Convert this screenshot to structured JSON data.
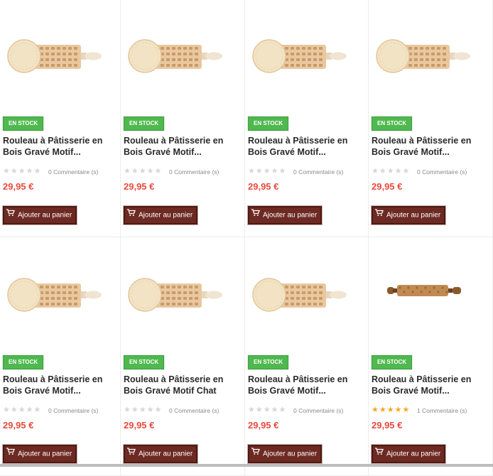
{
  "products": [
    {
      "stock": "EN STOCK",
      "title": "Rouleau à Pâtisserie en Bois Gravé Motif...",
      "rating": 0,
      "reviews": "0 Commentaire (s)",
      "price": "29,95 €",
      "cta": "Ajouter au panier",
      "variant": "cookie"
    },
    {
      "stock": "EN STOCK",
      "title": "Rouleau à Pâtisserie en Bois Gravé Motif...",
      "rating": 0,
      "reviews": "0 Commentaire (s)",
      "price": "29,95 €",
      "cta": "Ajouter au panier",
      "variant": "cookie"
    },
    {
      "stock": "EN STOCK",
      "title": "Rouleau à Pâtisserie en Bois Gravé Motif...",
      "rating": 0,
      "reviews": "0 Commentaire (s)",
      "price": "29,95 €",
      "cta": "Ajouter au panier",
      "variant": "cookie"
    },
    {
      "stock": "EN STOCK",
      "title": "Rouleau à Pâtisserie en Bois Gravé Motif...",
      "rating": 0,
      "reviews": "0 Commentaire (s)",
      "price": "29,95 €",
      "cta": "Ajouter au panier",
      "variant": "cookie"
    },
    {
      "stock": "EN STOCK",
      "title": "Rouleau à Pâtisserie en Bois Gravé Motif...",
      "rating": 0,
      "reviews": "0 Commentaire (s)",
      "price": "29,95 €",
      "cta": "Ajouter au panier",
      "variant": "cookie"
    },
    {
      "stock": "EN STOCK",
      "title": "Rouleau à Pâtisserie en Bois Gravé Motif Chat",
      "rating": 0,
      "reviews": "0 Commentaire (s)",
      "price": "29,95 €",
      "cta": "Ajouter au panier",
      "variant": "cookie"
    },
    {
      "stock": "EN STOCK",
      "title": "Rouleau à Pâtisserie en Bois Gravé Motif...",
      "rating": 0,
      "reviews": "0 Commentaire (s)",
      "price": "29,95 €",
      "cta": "Ajouter au panier",
      "variant": "cookie"
    },
    {
      "stock": "EN STOCK",
      "title": "Rouleau à Pâtisserie en Bois Gravé Motif...",
      "rating": 5,
      "reviews": "1 Commentaire (s)",
      "price": "29,95 €",
      "cta": "Ajouter au panier",
      "variant": "plain"
    }
  ],
  "colors": {
    "stock_badge": "#4fb84f",
    "price": "#e84a3c",
    "button": "#6d2a22",
    "star_on": "#f6a623",
    "star_off": "#d6d6d6"
  },
  "icons": {
    "cart": "shopping-cart-icon",
    "star": "star-icon"
  }
}
